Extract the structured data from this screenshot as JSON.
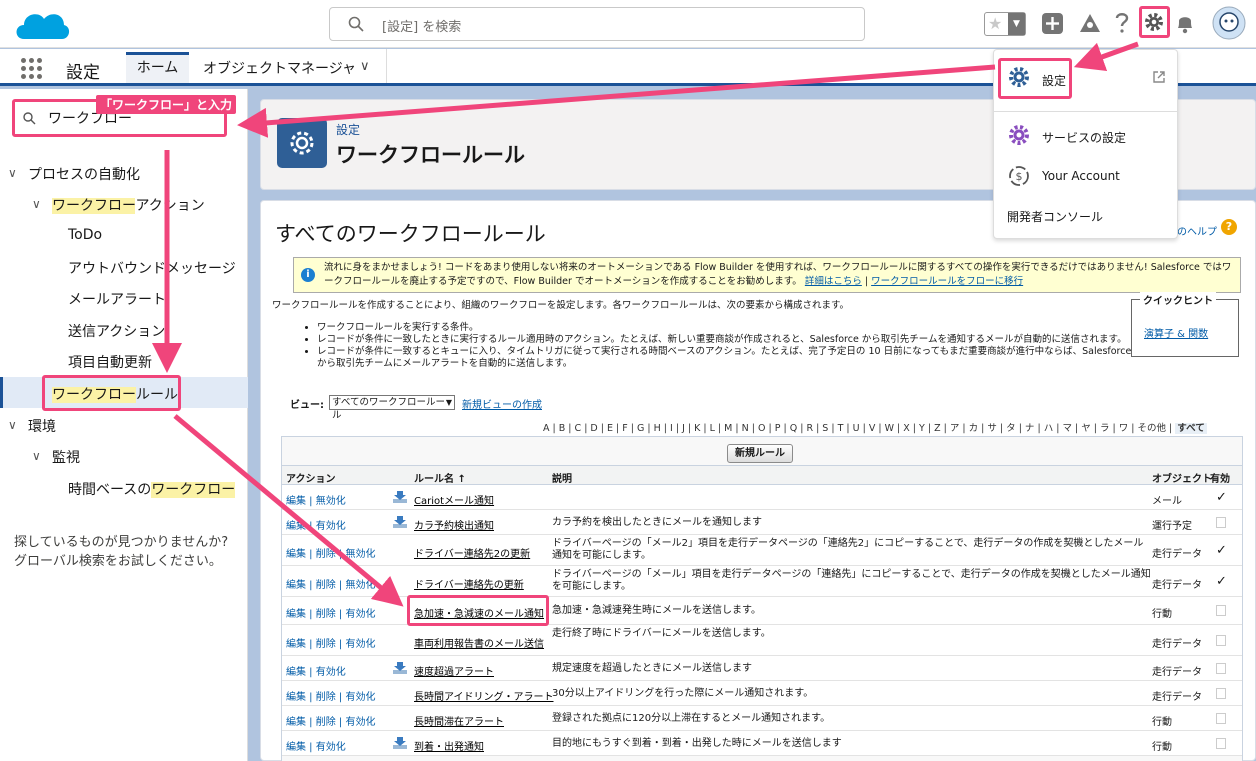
{
  "topbar": {
    "search_placeholder": "[設定] を検索",
    "fav_star": "★",
    "fav_dropdown": "▼",
    "add_label": "+",
    "help_label": "?"
  },
  "nav": {
    "app_name": "設定",
    "tabs": [
      {
        "label": "ホーム",
        "active": true
      },
      {
        "label": "オブジェクトマネージャ",
        "active": false
      }
    ],
    "tab_chevron": "∨"
  },
  "sidebar": {
    "quick_find_value": "ワークフロー",
    "annotation": "「ワークフロー」と入力",
    "tree": {
      "process": "プロセスの自動化",
      "wf_actions_hl": "ワークフロー",
      "wf_actions_rest": "アクション",
      "todo": "ToDo",
      "outbound": "アウトバウンドメッセージ",
      "email_alert": "メールアラート",
      "send_action": "送信アクション",
      "field_update": "項目自動更新",
      "wf_rule_hl": "ワークフロー",
      "wf_rule_rest": "ルール",
      "env": "環境",
      "monitor": "監視",
      "time_based_pre": "時間ベースの",
      "time_based_hl": "ワークフロー"
    },
    "not_found_1": "探しているものが見つかりませんか?",
    "not_found_2": "グローバル検索をお試しください。",
    "chevron": "∨"
  },
  "header": {
    "breadcrumb": "設定",
    "title": "ワークフロールール"
  },
  "main": {
    "title": "すべてのワークフロールール",
    "help_link": "のヘルプ",
    "help_q": "?",
    "notice_icon": "i",
    "notice_text": "流れに身をまかせましょう! コードをあまり使用しない将来のオートメーションである Flow Builder を使用すれば、ワークフロールールに関するすべての操作を実行できるだけではありません! Salesforce ではワークフロールールを廃止する予定ですので、Flow Builder でオートメーションを作成することをお勧めします。",
    "notice_link1": "詳細はこちら",
    "notice_sep": "|",
    "notice_link2": "ワークフロールールをフローに移行",
    "intro": "ワークフロールールを作成することにより、組織のワークフローを設定します。各ワークフロールールは、次の要素から構成されます。",
    "bullets": [
      "ワークフロールールを実行する条件。",
      "レコードが条件に一致したときに実行するルール適用時のアクション。たとえば、新しい重要商談が作成されると、Salesforce から取引先チームを通知するメールが自動的に送信されます。",
      "レコードが条件に一致するとキューに入り、タイムトリガに従って実行される時間ベースのアクション。たとえば、完了予定日の 10 日前になってもまだ重要商談が進行中ならば、Salesforce から取引先チームにメールアラートを自動的に送信します。"
    ],
    "tips_title": "クイックヒント",
    "tips_link": "演算子 & 関数",
    "view_label": "ビュー:",
    "view_value": "すべてのワークフロールール",
    "view_new": "新規ビューの作成",
    "alphabet": [
      "A",
      "B",
      "C",
      "D",
      "E",
      "F",
      "G",
      "H",
      "I",
      "J",
      "K",
      "L",
      "M",
      "N",
      "O",
      "P",
      "Q",
      "R",
      "S",
      "T",
      "U",
      "V",
      "W",
      "X",
      "Y",
      "Z",
      "ア",
      "カ",
      "サ",
      "タ",
      "ナ",
      "ハ",
      "マ",
      "ヤ",
      "ラ",
      "ワ",
      "その他"
    ],
    "alphabet_all": "すべて",
    "new_rule": "新規ルール",
    "columns": {
      "action": "アクション",
      "name": "ルール名 ↑",
      "desc": "説明",
      "obj": "オブジェクト",
      "active": "有効"
    },
    "rows": [
      {
        "actions": "編集 | 無効化",
        "dl": true,
        "name": "Cariotメール通知",
        "desc": "",
        "obj": "メール",
        "active": true
      },
      {
        "actions": "編集 | 有効化",
        "dl": true,
        "name": "カラ予約検出通知",
        "desc": "カラ予約を検出したときにメールを通知します",
        "obj": "運行予定",
        "active": false
      },
      {
        "actions": "編集 | 削除 | 無効化",
        "dl": false,
        "name": "ドライバー連絡先2の更新",
        "desc": "ドライバーページの「メール2」項目を走行データページの「連絡先2」にコピーすることで、走行データの作成を契機としたメール通知を可能にします。",
        "obj": "走行データ",
        "active": true
      },
      {
        "actions": "編集 | 削除 | 無効化",
        "dl": false,
        "name": "ドライバー連絡先の更新",
        "desc": "ドライバーページの「メール」項目を走行データページの「連絡先」にコピーすることで、走行データの作成を契機としたメール通知を可能にします。",
        "obj": "走行データ",
        "active": true
      },
      {
        "actions": "編集 | 削除 | 有効化",
        "dl": false,
        "name": "急加速・急減速のメール通知",
        "desc": "急加速・急減速発生時にメールを送信します。",
        "obj": "行動",
        "active": false
      },
      {
        "actions": "編集 | 削除 | 有効化",
        "dl": false,
        "name": "車両利用報告書のメール送信",
        "desc": "走行終了時にドライバーにメールを送信します。",
        "obj": "走行データ",
        "active": false
      },
      {
        "actions": "編集 | 有効化",
        "dl": true,
        "name": "速度超過アラート",
        "desc": "規定速度を超過したときにメール送信します",
        "obj": "走行データ",
        "active": false
      },
      {
        "actions": "編集 | 削除 | 有効化",
        "dl": false,
        "name": "長時間アイドリング・アラート",
        "desc": "30分以上アイドリングを行った際にメール通知されます。",
        "obj": "走行データ",
        "active": false
      },
      {
        "actions": "編集 | 削除 | 有効化",
        "dl": false,
        "name": "長時間滞在アラート",
        "desc": "登録された拠点に120分以上滞在するとメール通知されます。",
        "obj": "行動",
        "active": false
      },
      {
        "actions": "編集 | 有効化",
        "dl": true,
        "name": "到着・出発通知",
        "desc": "目的地にもうすぐ到着・到着・出発した時にメールを送信します",
        "obj": "行動",
        "active": false
      }
    ]
  },
  "menu": {
    "setup": "設定",
    "service": "サービスの設定",
    "account": "Your Account",
    "dev_console": "開発者コンソール"
  },
  "colors": {
    "accent": "#f0457b",
    "brand": "#1b5297",
    "highlight": "#fbf2a6",
    "cloud": "#00a1e0"
  }
}
